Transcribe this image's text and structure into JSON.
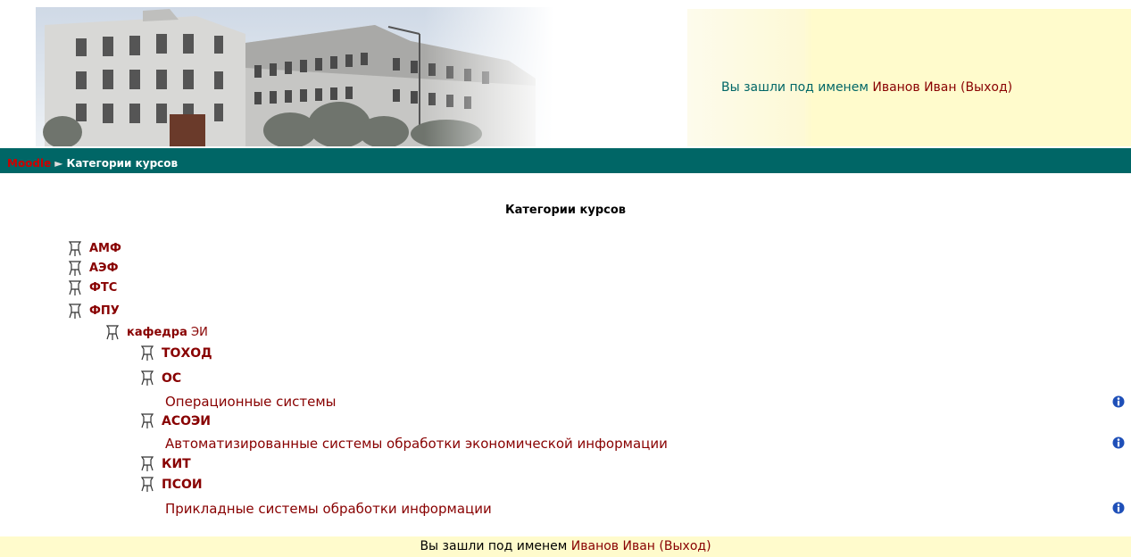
{
  "header": {
    "login_prefix": "Вы зашли под именем ",
    "user_name": "Иванов Иван",
    "logout_label": "(Выход)"
  },
  "navbar": {
    "home_label": "Moodle",
    "separator": "►",
    "current": "Категории курсов"
  },
  "page_title": "Категории курсов",
  "categories": {
    "amf": "АМФ",
    "aef": "АЭФ",
    "fts": "ФТС",
    "fpu": "ФПУ",
    "kafedra_prefix": "кафедра",
    "kafedra_suffix": " ЭИ",
    "tohod": "ТОХОД",
    "os": "ОС",
    "os_course": "Операционные системы",
    "asoei": "АСОЭИ",
    "asoei_course": "Автоматизированные системы обработки экономической информации",
    "kit": "КИТ",
    "psoi": "ПСОИ",
    "psoi_course": "Прикладные системы обработки информации"
  },
  "footer": {
    "login_prefix": "Вы зашли под именем ",
    "user_name": "Иванов Иван",
    "logout_label": "(Выход)"
  },
  "colors": {
    "navbar": "#006666",
    "link": "#880000",
    "login_bg": "#fffbcc"
  },
  "icons": [
    "folder-icon",
    "info-icon",
    "arrow-right-icon"
  ]
}
